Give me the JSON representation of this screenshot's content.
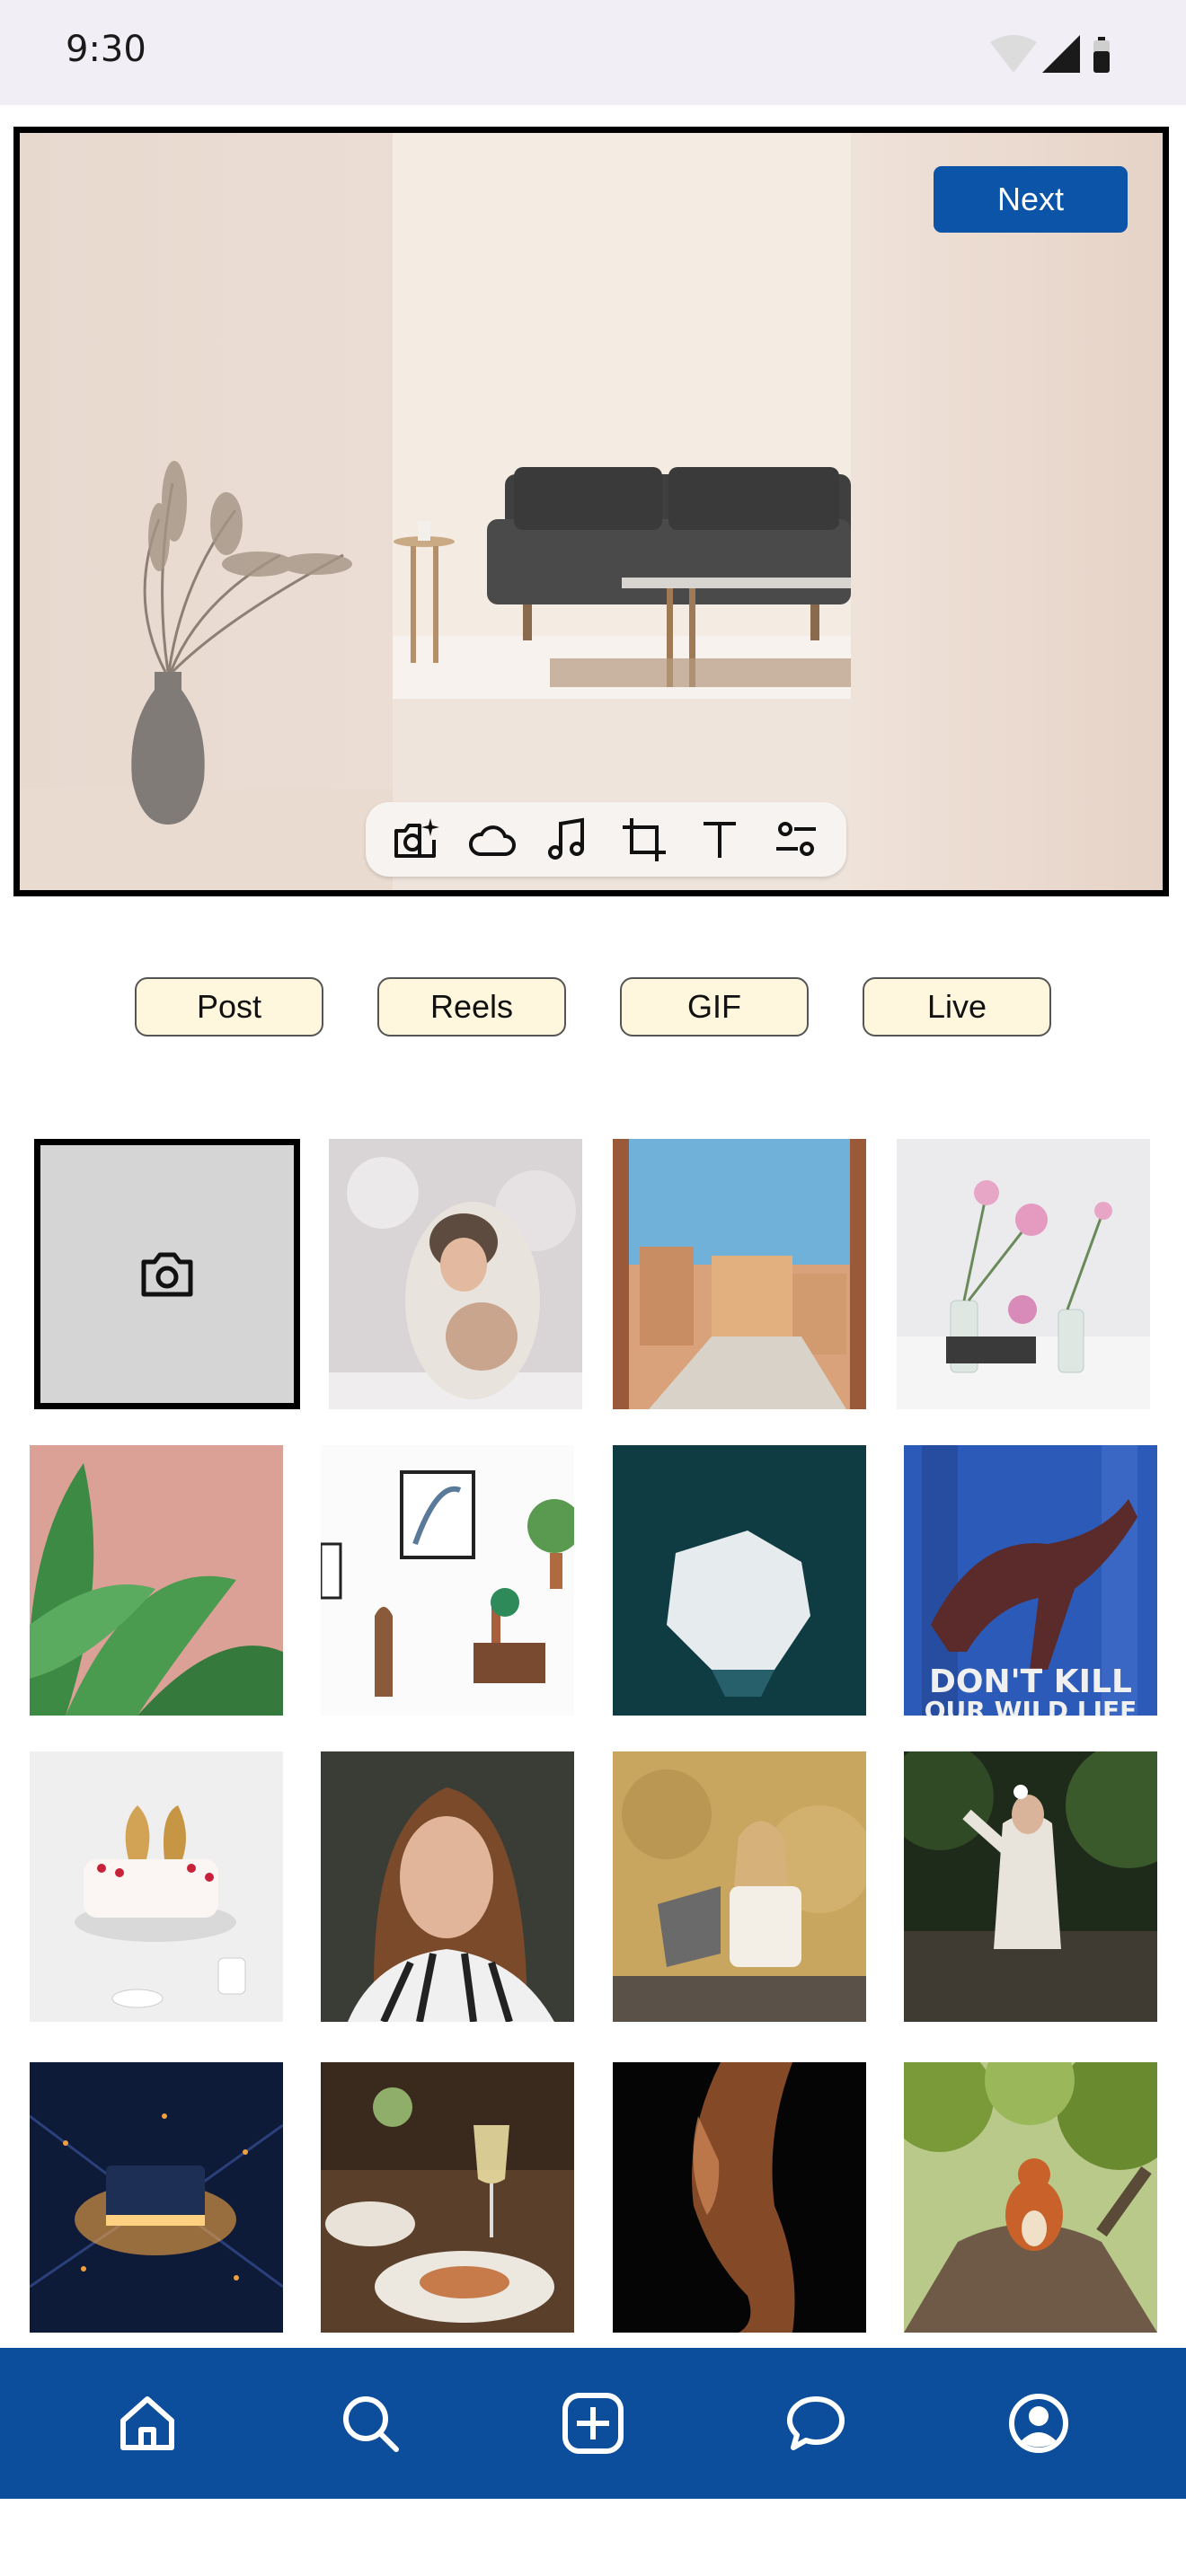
{
  "status_bar": {
    "time": "9:30"
  },
  "preview": {
    "next_label": "Next"
  },
  "toolbar": {
    "tools": [
      "camera-sparkle-icon",
      "cloud-icon",
      "music-note-icon",
      "crop-icon",
      "text-icon",
      "adjust-icon"
    ]
  },
  "modes": [
    "Post",
    "Reels",
    "GIF",
    "Live"
  ],
  "gallery": {
    "camera_icon": "camera-icon",
    "poster_text": "DON'T KILL OUR WILD LIFE"
  },
  "nav": {
    "items": [
      "home-icon",
      "search-icon",
      "add-post-icon",
      "chat-icon",
      "profile-icon"
    ]
  },
  "colors": {
    "accent": "#0c54a8",
    "nav_bg": "#0c4d9c",
    "mode_bg": "#fef6dd"
  }
}
